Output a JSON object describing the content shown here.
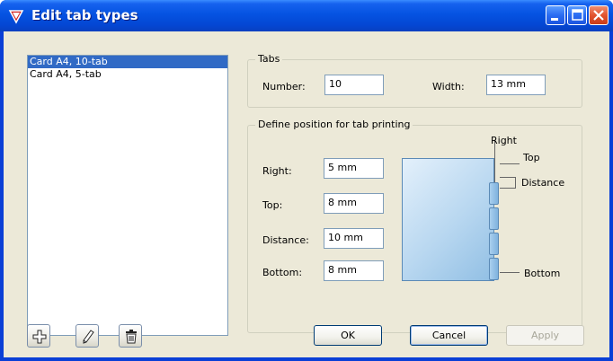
{
  "window": {
    "title": "Edit tab types",
    "controls": {
      "minimize": "minimize",
      "maximize": "maximize",
      "close": "close"
    }
  },
  "tab_type_list": {
    "items": [
      {
        "label": "Card A4, 10-tab",
        "selected": true
      },
      {
        "label": "Card A4, 5-tab",
        "selected": false
      }
    ]
  },
  "tabs_group": {
    "legend": "Tabs",
    "number_label": "Number:",
    "number_value": "10",
    "width_label": "Width:",
    "width_value": "13 mm"
  },
  "position_group": {
    "legend": "Define position for tab printing",
    "right_label": "Right:",
    "right_value": "5 mm",
    "top_label": "Top:",
    "top_value": "8 mm",
    "distance_label": "Distance:",
    "distance_value": "10 mm",
    "bottom_label": "Bottom:",
    "bottom_value": "8 mm"
  },
  "diagram": {
    "right": "Right",
    "top": "Top",
    "distance": "Distance",
    "bottom": "Bottom"
  },
  "list_toolbar": {
    "add_icon": "plus-icon",
    "edit_icon": "pencil-icon",
    "delete_icon": "trash-icon"
  },
  "buttons": {
    "ok": "OK",
    "cancel": "Cancel",
    "apply": "Apply",
    "apply_enabled": false
  },
  "colors": {
    "titlebar": "#0553e2",
    "selection": "#316ac5",
    "close_button": "#e2542e",
    "card_fill": "#b8d7f0"
  }
}
